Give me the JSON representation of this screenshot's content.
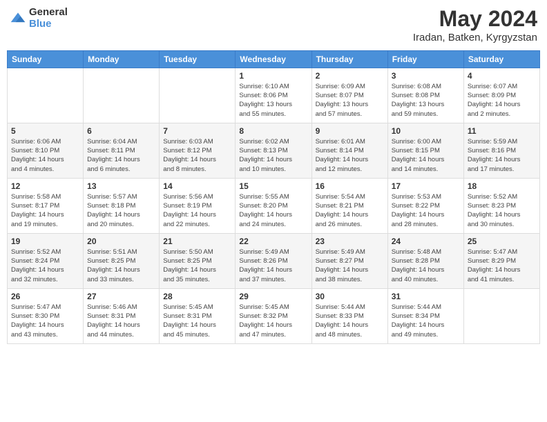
{
  "header": {
    "logo_general": "General",
    "logo_blue": "Blue",
    "month_title": "May 2024",
    "location": "Iradan, Batken, Kyrgyzstan"
  },
  "weekdays": [
    "Sunday",
    "Monday",
    "Tuesday",
    "Wednesday",
    "Thursday",
    "Friday",
    "Saturday"
  ],
  "weeks": [
    [
      {
        "day": "",
        "info": ""
      },
      {
        "day": "",
        "info": ""
      },
      {
        "day": "",
        "info": ""
      },
      {
        "day": "1",
        "info": "Sunrise: 6:10 AM\nSunset: 8:06 PM\nDaylight: 13 hours\nand 55 minutes."
      },
      {
        "day": "2",
        "info": "Sunrise: 6:09 AM\nSunset: 8:07 PM\nDaylight: 13 hours\nand 57 minutes."
      },
      {
        "day": "3",
        "info": "Sunrise: 6:08 AM\nSunset: 8:08 PM\nDaylight: 13 hours\nand 59 minutes."
      },
      {
        "day": "4",
        "info": "Sunrise: 6:07 AM\nSunset: 8:09 PM\nDaylight: 14 hours\nand 2 minutes."
      }
    ],
    [
      {
        "day": "5",
        "info": "Sunrise: 6:06 AM\nSunset: 8:10 PM\nDaylight: 14 hours\nand 4 minutes."
      },
      {
        "day": "6",
        "info": "Sunrise: 6:04 AM\nSunset: 8:11 PM\nDaylight: 14 hours\nand 6 minutes."
      },
      {
        "day": "7",
        "info": "Sunrise: 6:03 AM\nSunset: 8:12 PM\nDaylight: 14 hours\nand 8 minutes."
      },
      {
        "day": "8",
        "info": "Sunrise: 6:02 AM\nSunset: 8:13 PM\nDaylight: 14 hours\nand 10 minutes."
      },
      {
        "day": "9",
        "info": "Sunrise: 6:01 AM\nSunset: 8:14 PM\nDaylight: 14 hours\nand 12 minutes."
      },
      {
        "day": "10",
        "info": "Sunrise: 6:00 AM\nSunset: 8:15 PM\nDaylight: 14 hours\nand 14 minutes."
      },
      {
        "day": "11",
        "info": "Sunrise: 5:59 AM\nSunset: 8:16 PM\nDaylight: 14 hours\nand 17 minutes."
      }
    ],
    [
      {
        "day": "12",
        "info": "Sunrise: 5:58 AM\nSunset: 8:17 PM\nDaylight: 14 hours\nand 19 minutes."
      },
      {
        "day": "13",
        "info": "Sunrise: 5:57 AM\nSunset: 8:18 PM\nDaylight: 14 hours\nand 20 minutes."
      },
      {
        "day": "14",
        "info": "Sunrise: 5:56 AM\nSunset: 8:19 PM\nDaylight: 14 hours\nand 22 minutes."
      },
      {
        "day": "15",
        "info": "Sunrise: 5:55 AM\nSunset: 8:20 PM\nDaylight: 14 hours\nand 24 minutes."
      },
      {
        "day": "16",
        "info": "Sunrise: 5:54 AM\nSunset: 8:21 PM\nDaylight: 14 hours\nand 26 minutes."
      },
      {
        "day": "17",
        "info": "Sunrise: 5:53 AM\nSunset: 8:22 PM\nDaylight: 14 hours\nand 28 minutes."
      },
      {
        "day": "18",
        "info": "Sunrise: 5:52 AM\nSunset: 8:23 PM\nDaylight: 14 hours\nand 30 minutes."
      }
    ],
    [
      {
        "day": "19",
        "info": "Sunrise: 5:52 AM\nSunset: 8:24 PM\nDaylight: 14 hours\nand 32 minutes."
      },
      {
        "day": "20",
        "info": "Sunrise: 5:51 AM\nSunset: 8:25 PM\nDaylight: 14 hours\nand 33 minutes."
      },
      {
        "day": "21",
        "info": "Sunrise: 5:50 AM\nSunset: 8:25 PM\nDaylight: 14 hours\nand 35 minutes."
      },
      {
        "day": "22",
        "info": "Sunrise: 5:49 AM\nSunset: 8:26 PM\nDaylight: 14 hours\nand 37 minutes."
      },
      {
        "day": "23",
        "info": "Sunrise: 5:49 AM\nSunset: 8:27 PM\nDaylight: 14 hours\nand 38 minutes."
      },
      {
        "day": "24",
        "info": "Sunrise: 5:48 AM\nSunset: 8:28 PM\nDaylight: 14 hours\nand 40 minutes."
      },
      {
        "day": "25",
        "info": "Sunrise: 5:47 AM\nSunset: 8:29 PM\nDaylight: 14 hours\nand 41 minutes."
      }
    ],
    [
      {
        "day": "26",
        "info": "Sunrise: 5:47 AM\nSunset: 8:30 PM\nDaylight: 14 hours\nand 43 minutes."
      },
      {
        "day": "27",
        "info": "Sunrise: 5:46 AM\nSunset: 8:31 PM\nDaylight: 14 hours\nand 44 minutes."
      },
      {
        "day": "28",
        "info": "Sunrise: 5:45 AM\nSunset: 8:31 PM\nDaylight: 14 hours\nand 45 minutes."
      },
      {
        "day": "29",
        "info": "Sunrise: 5:45 AM\nSunset: 8:32 PM\nDaylight: 14 hours\nand 47 minutes."
      },
      {
        "day": "30",
        "info": "Sunrise: 5:44 AM\nSunset: 8:33 PM\nDaylight: 14 hours\nand 48 minutes."
      },
      {
        "day": "31",
        "info": "Sunrise: 5:44 AM\nSunset: 8:34 PM\nDaylight: 14 hours\nand 49 minutes."
      },
      {
        "day": "",
        "info": ""
      }
    ]
  ]
}
